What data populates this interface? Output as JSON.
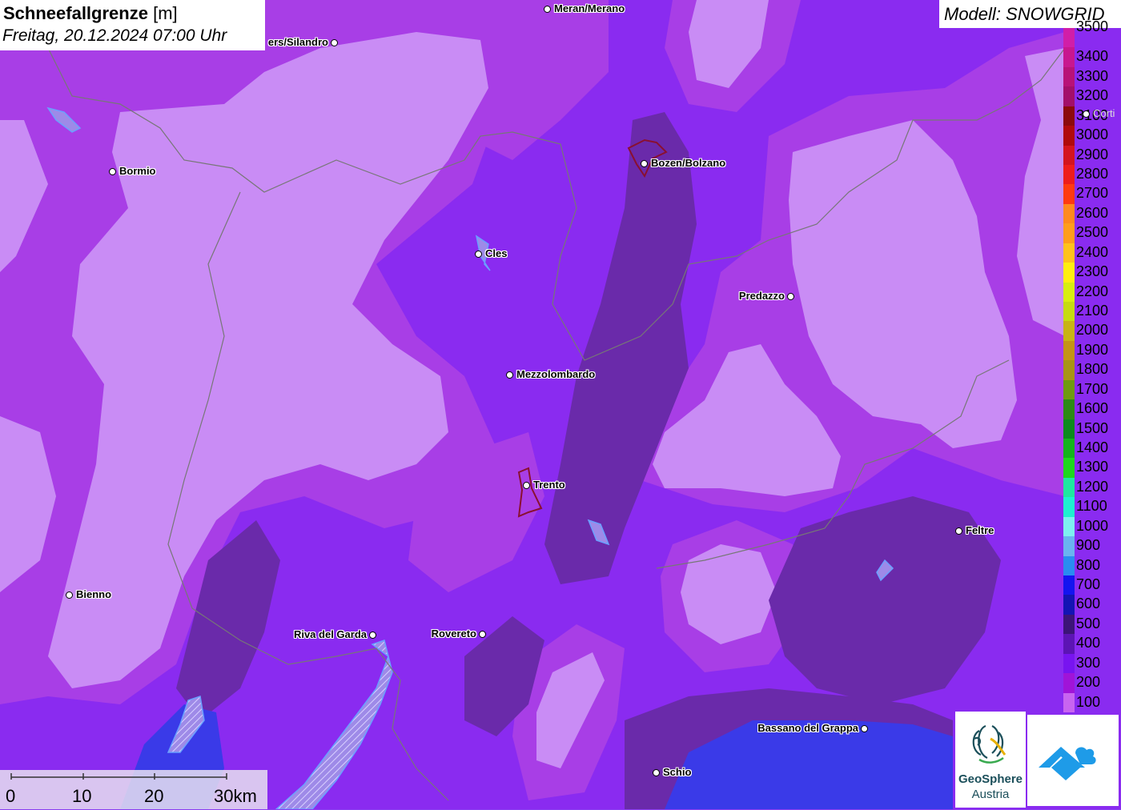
{
  "title": {
    "main": "Schneefallgrenze",
    "unit": "[m]",
    "datetime": "Freitag, 20.12.2024 07:00 Uhr"
  },
  "model": {
    "label": "Modell: SNOWGRID"
  },
  "legend": {
    "items": [
      {
        "label": "3500",
        "color": "#d11ea8"
      },
      {
        "label": "3400",
        "color": "#c8178f"
      },
      {
        "label": "3300",
        "color": "#b81278"
      },
      {
        "label": "3200",
        "color": "#a30f6a"
      },
      {
        "label": "3100",
        "color": "#8c0a0a"
      },
      {
        "label": "3000",
        "color": "#b00a0a"
      },
      {
        "label": "2900",
        "color": "#d4141e"
      },
      {
        "label": "2800",
        "color": "#ee1c1c"
      },
      {
        "label": "2700",
        "color": "#ff3a10"
      },
      {
        "label": "2600",
        "color": "#ff8a1e"
      },
      {
        "label": "2500",
        "color": "#ff9d1c"
      },
      {
        "label": "2400",
        "color": "#ffc21c"
      },
      {
        "label": "2300",
        "color": "#ffee10"
      },
      {
        "label": "2200",
        "color": "#d8ee10"
      },
      {
        "label": "2100",
        "color": "#c6dc10"
      },
      {
        "label": "2000",
        "color": "#c8b414"
      },
      {
        "label": "1900",
        "color": "#c49414"
      },
      {
        "label": "1800",
        "color": "#a89414"
      },
      {
        "label": "1700",
        "color": "#6f9a10"
      },
      {
        "label": "1600",
        "color": "#2c8a14"
      },
      {
        "label": "1500",
        "color": "#0c8a1c"
      },
      {
        "label": "1400",
        "color": "#14b41c"
      },
      {
        "label": "1300",
        "color": "#1ed81e"
      },
      {
        "label": "1200",
        "color": "#1ee8a0"
      },
      {
        "label": "1100",
        "color": "#1ef0d0"
      },
      {
        "label": "1000",
        "color": "#7ef0f0"
      },
      {
        "label": "900",
        "color": "#6ab4f0"
      },
      {
        "label": "800",
        "color": "#2a8cf0"
      },
      {
        "label": "700",
        "color": "#1414f0"
      },
      {
        "label": "600",
        "color": "#1414b4"
      },
      {
        "label": "500",
        "color": "#3c1478"
      },
      {
        "label": "400",
        "color": "#5c14b4"
      },
      {
        "label": "300",
        "color": "#7814f0"
      },
      {
        "label": "200",
        "color": "#a014d8"
      },
      {
        "label": "100",
        "color": "#c864f0"
      }
    ]
  },
  "cities": [
    {
      "name": "Meran/Merano",
      "side": "right"
    },
    {
      "name": "ers/Silandro",
      "side": "left"
    },
    {
      "name": "Bormio",
      "side": "right"
    },
    {
      "name": "Bozen/Bolzano",
      "side": "right"
    },
    {
      "name": "Cles",
      "side": "right"
    },
    {
      "name": "Predazzo",
      "side": "left"
    },
    {
      "name": "Mezzolombardo",
      "side": "right"
    },
    {
      "name": "Trento",
      "side": "right"
    },
    {
      "name": "Feltre",
      "side": "right"
    },
    {
      "name": "Bienno",
      "side": "right"
    },
    {
      "name": "Riva del Garda",
      "side": "left"
    },
    {
      "name": "Rovereto",
      "side": "left"
    },
    {
      "name": "Bassano del Grappa",
      "side": "left"
    },
    {
      "name": "Schio",
      "side": "right"
    },
    {
      "name": "Corti",
      "side": "right"
    }
  ],
  "scalebar": {
    "labels": [
      "0",
      "10",
      "20",
      "30km"
    ]
  },
  "logos": {
    "geosphere_line1": "GeoSphere",
    "geosphere_line2": "Austria"
  },
  "colors": {
    "light_zone": "#c98cf5",
    "mid_zone": "#a83ee6",
    "purple_zone": "#8a2bf0",
    "dark_zone": "#6a2aaa",
    "blue_zone": "#3a3ae8"
  }
}
